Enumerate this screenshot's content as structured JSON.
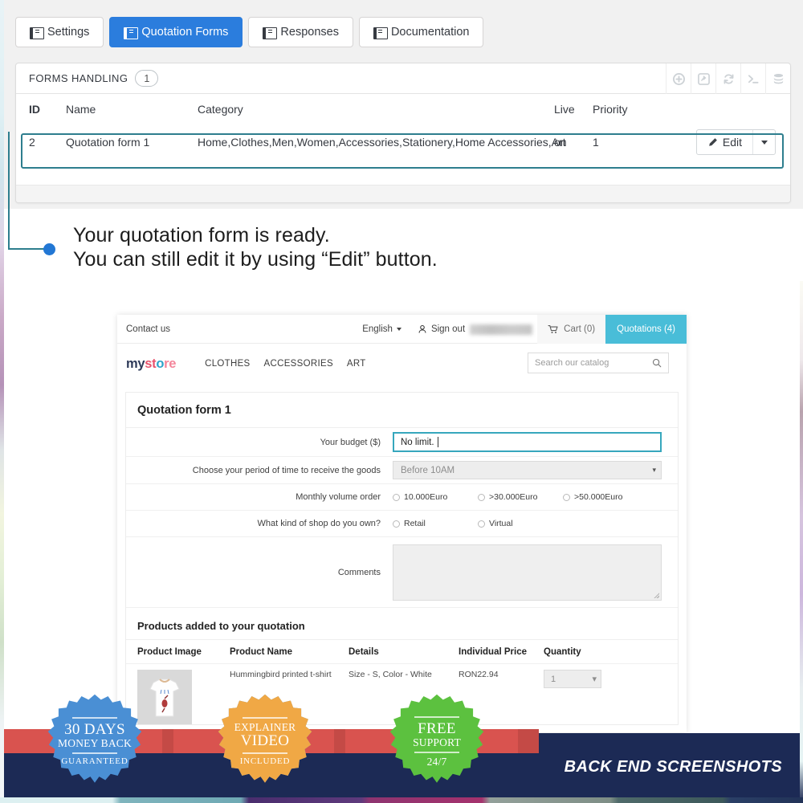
{
  "admin": {
    "tabs": [
      {
        "label": "Settings",
        "icon": "book-icon",
        "active": false
      },
      {
        "label": "Quotation Forms",
        "icon": "book-icon",
        "active": true
      },
      {
        "label": "Responses",
        "icon": "book-icon",
        "active": false
      },
      {
        "label": "Documentation",
        "icon": "book-icon",
        "active": false
      }
    ],
    "panel": {
      "title": "FORMS HANDLING",
      "count": "1",
      "tools": [
        {
          "name": "add-icon",
          "title": "Add"
        },
        {
          "name": "export-icon",
          "title": "Export"
        },
        {
          "name": "refresh-icon",
          "title": "Refresh"
        },
        {
          "name": "terminal-icon",
          "title": "SQL query"
        },
        {
          "name": "database-icon",
          "title": "Show SQL"
        }
      ],
      "columns": [
        "ID",
        "Name",
        "Category",
        "Live",
        "Priority"
      ],
      "rows": [
        {
          "id": "2",
          "name": "Quotation form 1",
          "category": "Home,Clothes,Men,Women,Accessories,Stationery,Home Accessories,Art",
          "live": "on",
          "priority": "1",
          "action_label": "Edit"
        }
      ]
    }
  },
  "callout": {
    "line1": "Your quotation form is ready.",
    "line2": "You can still edit it by using “Edit” button."
  },
  "store": {
    "topbar": {
      "contact": "Contact us",
      "language": "English",
      "signout": "Sign out",
      "customer_blurred": "",
      "cart": "Cart (0)",
      "quotations": "Quotations (4)"
    },
    "logo": {
      "part1": "my",
      "part2": "st",
      "part3": "o",
      "part4": "re"
    },
    "menu": [
      "CLOTHES",
      "ACCESSORIES",
      "ART"
    ],
    "search_placeholder": "Search our catalog",
    "form": {
      "title": "Quotation form 1",
      "fields": [
        {
          "label": "Your budget ($)",
          "type": "text",
          "value": "No limit.",
          "focused": true
        },
        {
          "label": "Choose your period of time to receive the goods",
          "type": "select",
          "value": "Before 10AM"
        },
        {
          "label": "Monthly volume order",
          "type": "radio",
          "options": [
            "10.000Euro",
            ">30.000Euro",
            ">50.000Euro"
          ]
        },
        {
          "label": "What kind of shop do you own?",
          "type": "radio",
          "options": [
            "Retail",
            "Virtual"
          ]
        },
        {
          "label": "Comments",
          "type": "textarea",
          "value": ""
        }
      ]
    },
    "products": {
      "title": "Products added to your quotation",
      "columns": [
        "Product Image",
        "Product Name",
        "Details",
        "Individual Price",
        "Quantity"
      ],
      "rows": [
        {
          "name": "Hummingbird printed t-shirt",
          "details": "Size - S, Color - White",
          "price": "RON22.94",
          "quantity": "1"
        }
      ]
    }
  },
  "footer": {
    "caption": "BACK END SCREENSHOTS",
    "badges": [
      {
        "line1": "30 DAYS",
        "line2": "MONEY BACK",
        "line3": "GUARANTEED",
        "color": "#4a8fd4"
      },
      {
        "line1": "EXPLAINER",
        "line2": "VIDEO",
        "line3": "INCLUDED",
        "color": "#f0a845"
      },
      {
        "line1": "FREE",
        "line2": "SUPPORT",
        "line3": "24/7",
        "color": "#5cc martin"
      }
    ]
  },
  "colors": {
    "accent_blue": "#2b7ddd",
    "callout_teal": "#2e7e8e",
    "quotations_teal": "#49bdd8",
    "footer_navy": "#1c2a55"
  }
}
